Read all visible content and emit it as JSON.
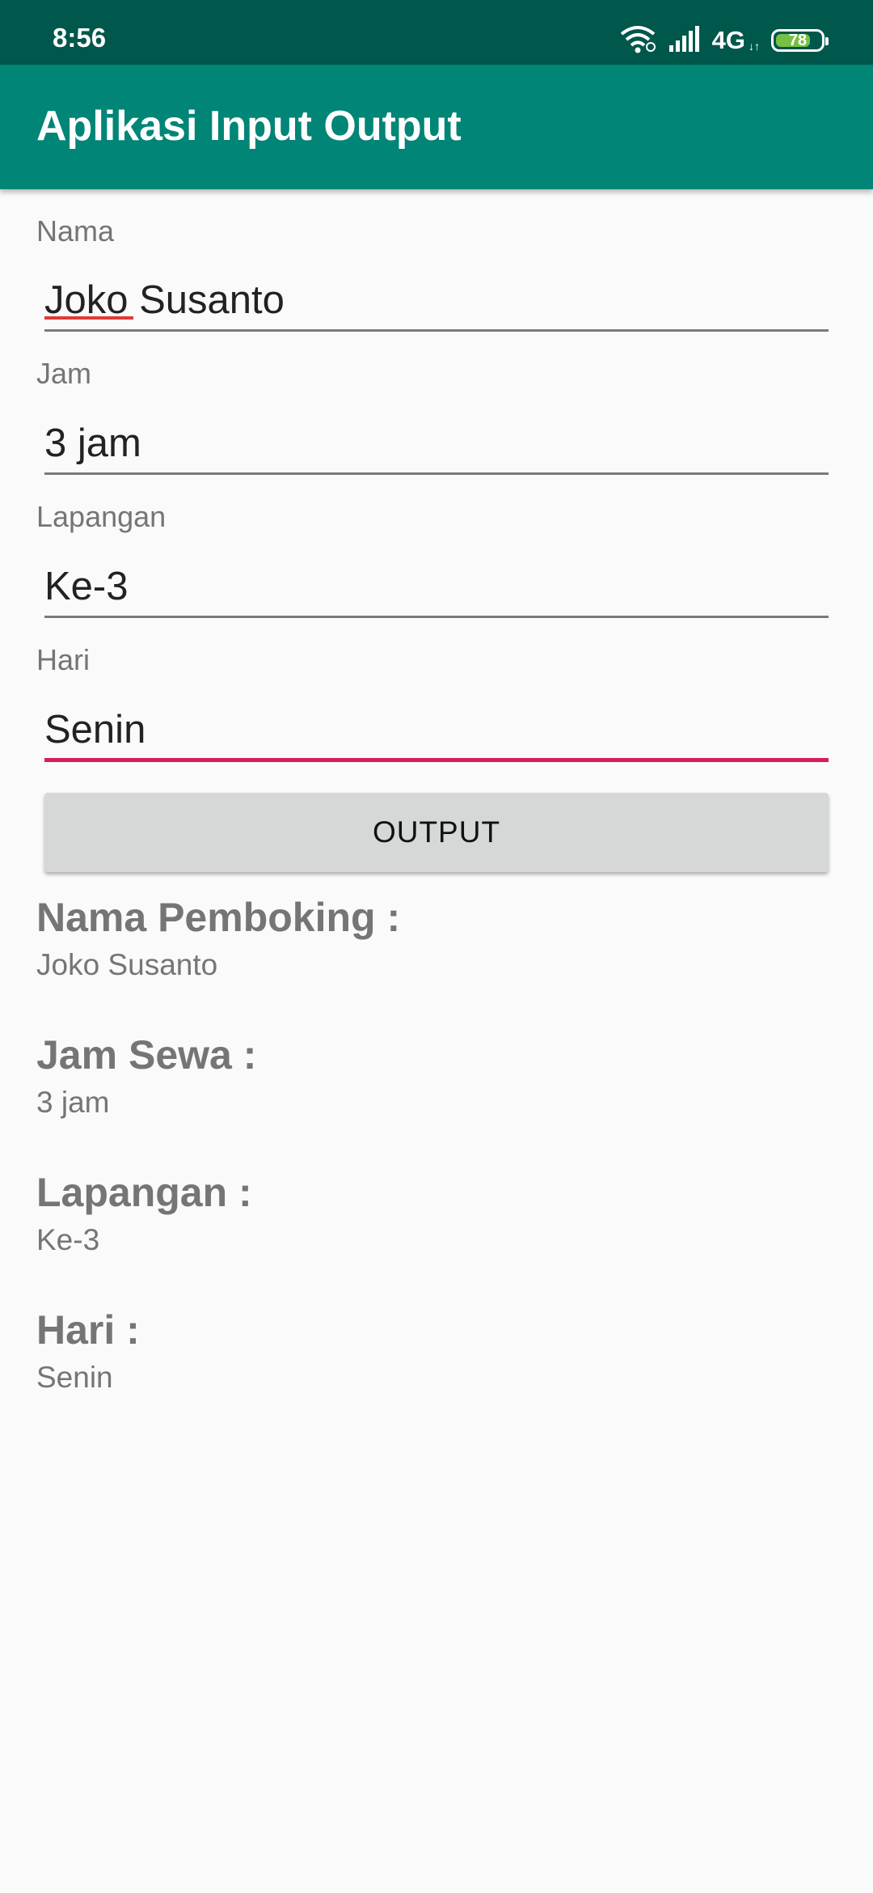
{
  "status_bar": {
    "time": "8:56",
    "network_label": "4G",
    "battery_level": 78,
    "battery_text": "78",
    "icons": [
      "wifi-icon",
      "signal-icon",
      "battery-icon"
    ]
  },
  "app_bar": {
    "title": "Aplikasi Input Output"
  },
  "form": {
    "nama": {
      "label": "Nama",
      "value": "Joko Susanto"
    },
    "jam": {
      "label": "Jam",
      "value": "3 jam"
    },
    "lapangan": {
      "label": "Lapangan",
      "value": "Ke-3"
    },
    "hari": {
      "label": "Hari",
      "value": "Senin"
    },
    "output_button": "OUTPUT"
  },
  "output": {
    "nama": {
      "heading": "Nama Pemboking :",
      "value": "Joko Susanto"
    },
    "jam": {
      "heading": "Jam Sewa :",
      "value": "3 jam"
    },
    "lapangan": {
      "heading": "Lapangan :",
      "value": "Ke-3"
    },
    "hari": {
      "heading": "Hari :",
      "value": "Senin"
    }
  },
  "colors": {
    "status_bar": "#00574b",
    "app_bar": "#008577",
    "accent": "#d81b60",
    "battery_fill": "#76c043"
  }
}
